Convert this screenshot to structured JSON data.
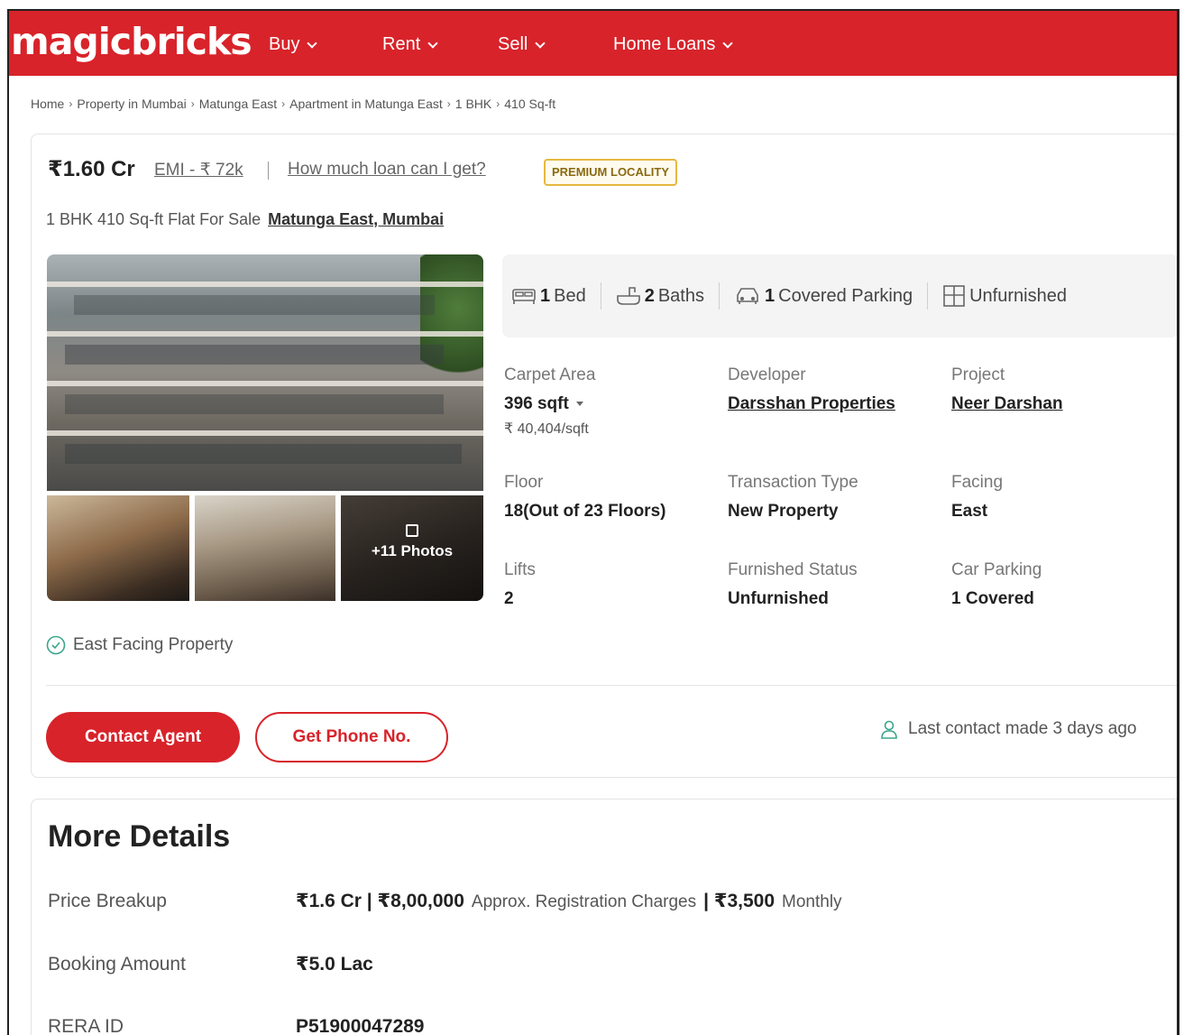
{
  "header": {
    "logo": "magicbricks",
    "nav": [
      {
        "label": "Buy"
      },
      {
        "label": "Rent"
      },
      {
        "label": "Sell"
      },
      {
        "label": "Home Loans"
      }
    ]
  },
  "breadcrumb": [
    "Home",
    "Property in Mumbai",
    "Matunga East",
    "Apartment in Matunga East",
    "1 BHK",
    "410 Sq-ft"
  ],
  "listing": {
    "price": "₹1.60 Cr",
    "emi": "EMI - ₹ 72k",
    "loan_link": "How much loan can I get?",
    "badge": "PREMIUM LOCALITY",
    "subtitle": "1 BHK 410 Sq-ft Flat For Sale",
    "location": "Matunga East, Mumbai",
    "photos_more": "+11 Photos",
    "features": [
      {
        "icon": "bed-icon",
        "value": "1",
        "label": "Bed"
      },
      {
        "icon": "bath-icon",
        "value": "2",
        "label": "Baths"
      },
      {
        "icon": "car-icon",
        "value": "1",
        "label": "Covered Parking"
      },
      {
        "icon": "furniture-icon",
        "value": "",
        "label": "Unfurnished"
      }
    ],
    "details": {
      "carpet_area": {
        "label": "Carpet Area",
        "value": "396 sqft",
        "sub": "₹ 40,404/sqft"
      },
      "developer": {
        "label": "Developer",
        "value": "Darsshan Properties"
      },
      "project": {
        "label": "Project",
        "value": "Neer Darshan"
      },
      "floor": {
        "label": "Floor",
        "value": "18(Out of 23 Floors)"
      },
      "transaction": {
        "label": "Transaction Type",
        "value": "New Property"
      },
      "facing": {
        "label": "Facing",
        "value": "East"
      },
      "lifts": {
        "label": "Lifts",
        "value": "2"
      },
      "furnished": {
        "label": "Furnished Status",
        "value": "Unfurnished"
      },
      "car_parking": {
        "label": "Car Parking",
        "value": "1 Covered"
      }
    },
    "facing_note": "East Facing Property",
    "contact_btn": "Contact Agent",
    "phone_btn": "Get Phone No.",
    "last_contact": "Last contact made 3 days ago"
  },
  "more_details": {
    "title": "More Details",
    "price_breakup": {
      "label": "Price Breakup",
      "value1": "₹1.6 Cr | ₹8,00,000",
      "note1": "Approx. Registration Charges",
      "value2": "| ₹3,500",
      "note2": "Monthly"
    },
    "booking": {
      "label": "Booking Amount",
      "value": "₹5.0 Lac"
    },
    "rera": {
      "label": "RERA ID",
      "value": "P51900047289"
    }
  },
  "colors": {
    "brand": "#d8232a",
    "badge_border": "#e6b840"
  }
}
